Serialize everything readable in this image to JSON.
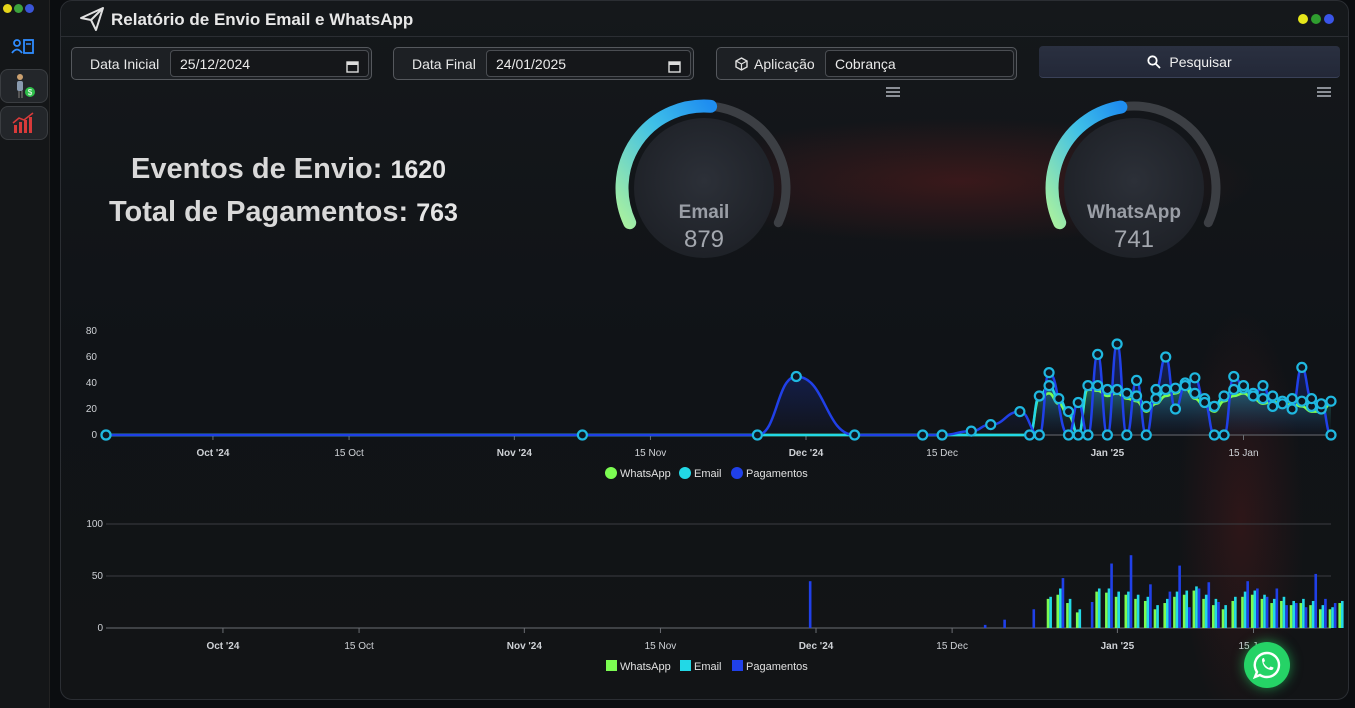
{
  "app": {
    "title": "Relatório de Envio Email e WhatsApp"
  },
  "filters": {
    "data_inicial_label": "Data Inicial",
    "data_inicial_value": "25/12/2024",
    "data_final_label": "Data Final",
    "data_final_value": "24/01/2025",
    "aplicacao_label": "Aplicação",
    "aplicacao_value": "Cobrança",
    "search_label": "Pesquisar"
  },
  "stats": {
    "eventos_label": "Eventos de Envio:",
    "eventos_value": "1620",
    "pagamentos_label": "Total de Pagamentos:",
    "pagamentos_value": "763"
  },
  "gauges": {
    "email": {
      "label": "Email",
      "value": "879",
      "fraction": 0.52
    },
    "whatsapp": {
      "label": "WhatsApp",
      "value": "741",
      "fraction": 0.46
    }
  },
  "colors": {
    "whatsapp": "#7cfc52",
    "email": "#22d8e6",
    "pagamentos": "#2040e8",
    "gauge_track": "#3c3f44"
  },
  "chart_data": [
    {
      "type": "area",
      "x_ticks": [
        "Oct '24",
        "15 Oct",
        "Nov '24",
        "15 Nov",
        "Dec '24",
        "15 Dec",
        "Jan '25",
        "15 Jan"
      ],
      "y_ticks": [
        "0",
        "20",
        "40",
        "60",
        "80"
      ],
      "ylim": [
        0,
        80
      ],
      "legend": [
        "WhatsApp",
        "Email",
        "Pagamentos"
      ],
      "legend_position": "bottom",
      "series": [
        {
          "name": "Pagamentos",
          "x": [
            "2024-09-20",
            "2024-11-08",
            "2024-11-26",
            "2024-11-30",
            "2024-12-06",
            "2024-12-13",
            "2024-12-15",
            "2024-12-18",
            "2024-12-20",
            "2024-12-23",
            "2024-12-25",
            "2024-12-26",
            "2024-12-28",
            "2024-12-29",
            "2024-12-30",
            "2024-12-31",
            "2025-01-01",
            "2025-01-02",
            "2025-01-03",
            "2025-01-04",
            "2025-01-05",
            "2025-01-06",
            "2025-01-07",
            "2025-01-08",
            "2025-01-09",
            "2025-01-10",
            "2025-01-11",
            "2025-01-12",
            "2025-01-13",
            "2025-01-14",
            "2025-01-15",
            "2025-01-16",
            "2025-01-17",
            "2025-01-18",
            "2025-01-19",
            "2025-01-20",
            "2025-01-21",
            "2025-01-22",
            "2025-01-23",
            "2025-01-24"
          ],
          "y": [
            0,
            0,
            0,
            45,
            0,
            0,
            0,
            3,
            8,
            18,
            0,
            48,
            0,
            25,
            0,
            62,
            0,
            70,
            0,
            42,
            0,
            35,
            60,
            20,
            38,
            44,
            25,
            0,
            0,
            45,
            38,
            30,
            38,
            22,
            24,
            20,
            52,
            28,
            24,
            0
          ],
          "color": "#2040e8"
        },
        {
          "name": "Email",
          "x": [
            "2024-12-24",
            "2024-12-25",
            "2024-12-26",
            "2024-12-27",
            "2024-12-28",
            "2024-12-29",
            "2024-12-30",
            "2024-12-31",
            "2025-01-01",
            "2025-01-02",
            "2025-01-03",
            "2025-01-04",
            "2025-01-05",
            "2025-01-06",
            "2025-01-07",
            "2025-01-08",
            "2025-01-09",
            "2025-01-10",
            "2025-01-11",
            "2025-01-12",
            "2025-01-13",
            "2025-01-14",
            "2025-01-15",
            "2025-01-16",
            "2025-01-17",
            "2025-01-18",
            "2025-01-19",
            "2025-01-20",
            "2025-01-21",
            "2025-01-22",
            "2025-01-23",
            "2025-01-24"
          ],
          "y": [
            0,
            30,
            38,
            28,
            18,
            0,
            38,
            38,
            35,
            35,
            32,
            30,
            22,
            28,
            35,
            36,
            40,
            32,
            28,
            22,
            30,
            35,
            36,
            32,
            28,
            30,
            26,
            28,
            26,
            22,
            20,
            26
          ],
          "color": "#22d8e6"
        },
        {
          "name": "WhatsApp",
          "x": [
            "2024-12-24",
            "2024-12-25",
            "2024-12-26",
            "2024-12-27",
            "2024-12-28",
            "2024-12-29",
            "2024-12-30",
            "2024-12-31",
            "2025-01-01",
            "2025-01-02",
            "2025-01-03",
            "2025-01-04",
            "2025-01-05",
            "2025-01-06",
            "2025-01-07",
            "2025-01-08",
            "2025-01-09",
            "2025-01-10",
            "2025-01-11",
            "2025-01-12",
            "2025-01-13",
            "2025-01-14",
            "2025-01-15",
            "2025-01-16",
            "2025-01-17",
            "2025-01-18",
            "2025-01-19",
            "2025-01-20",
            "2025-01-21",
            "2025-01-22",
            "2025-01-23",
            "2025-01-24"
          ],
          "y": [
            0,
            28,
            32,
            24,
            15,
            0,
            35,
            34,
            30,
            32,
            28,
            26,
            18,
            24,
            30,
            32,
            36,
            28,
            22,
            18,
            26,
            30,
            32,
            28,
            24,
            26,
            22,
            24,
            22,
            18,
            18,
            24
          ],
          "color": "#7cfc52"
        }
      ]
    },
    {
      "type": "bar",
      "x_ticks": [
        "Oct '24",
        "15 Oct",
        "Nov '24",
        "15 Nov",
        "Dec '24",
        "15 Dec",
        "Jan '25",
        "15 Jan"
      ],
      "y_ticks": [
        "0",
        "50",
        "100"
      ],
      "ylim": [
        0,
        100
      ],
      "legend": [
        "WhatsApp",
        "Email",
        "Pagamentos"
      ],
      "legend_position": "bottom"
    }
  ]
}
